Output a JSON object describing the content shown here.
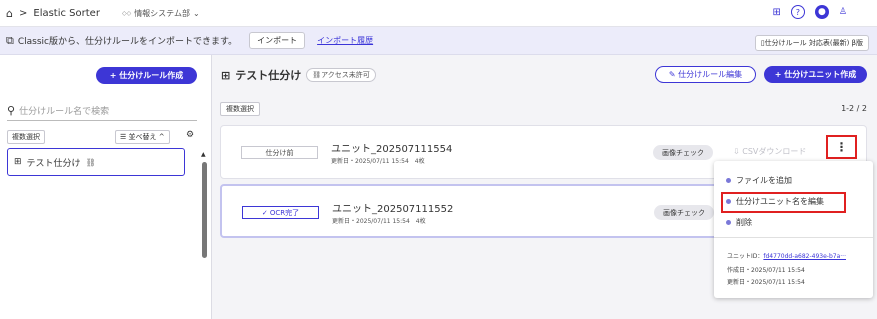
{
  "topbar": {
    "home_icon": "home-icon",
    "separator": ">",
    "app_name": "Elastic Sorter",
    "department": "情報システム部",
    "dept_caret": "⌄"
  },
  "banner": {
    "message": "Classic版から、仕分けルールをインポートできます。",
    "import_label": "インポート",
    "history_label": "インポート履歴",
    "compat_label": "仕分けルール 対応表(最新) β版"
  },
  "sidebar": {
    "create_rule_label": "+ 仕分けルール作成",
    "search_placeholder": "仕分けルール名で検索",
    "multi_select_label": "複数選択",
    "sort_label": "並べ替え ^",
    "items": [
      {
        "label": "テスト仕分け"
      }
    ]
  },
  "main": {
    "title": "テスト仕分け",
    "access_label": "アクセス未許可",
    "edit_rule_label": "仕分けルール編集",
    "create_unit_label": "+ 仕分けユニット作成",
    "multi_select_label": "複数選択",
    "pagination": "1-2 / 2",
    "units": [
      {
        "status": "仕分け前",
        "name": "ユニット_202507111554",
        "meta": "更新日・2025/07/11 15:54　4枚",
        "image_check": "画像チェック",
        "csv": "CSVダウンロード"
      },
      {
        "status": "✓ OCR完了",
        "name": "ユニット_202507111552",
        "meta": "更新日・2025/07/11 15:54　4枚",
        "image_check": "画像チェック"
      }
    ]
  },
  "menu": {
    "kebab": "⋮",
    "items": [
      {
        "label": "ファイルを追加"
      },
      {
        "label": "仕分けユニット名を編集"
      },
      {
        "label": "削除"
      }
    ],
    "unit_id_label": "ユニットID：",
    "unit_id_value": "fd4770dd-a682-493e-b7a···",
    "created": "作成日・2025/07/11 15:54",
    "updated": "更新日・2025/07/11 15:54"
  },
  "colors": {
    "accent": "#3d36d6",
    "highlight": "#e02020",
    "banner_bg": "#ececfa"
  }
}
